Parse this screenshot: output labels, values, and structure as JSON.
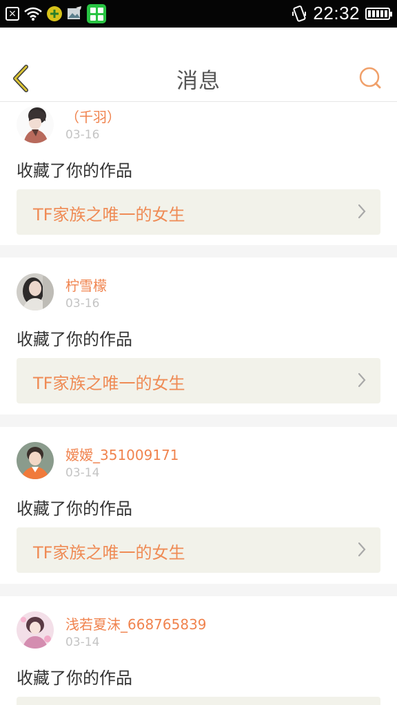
{
  "status_bar": {
    "time": "22:32",
    "icons": [
      "close-box-icon",
      "wifi-icon",
      "plus-app-icon",
      "image-app-icon",
      "grid-app-icon",
      "vibrate-icon",
      "battery-icon"
    ]
  },
  "header": {
    "title": "消息",
    "back_icon": "chevron-left-icon",
    "search_icon": "search-icon"
  },
  "colors": {
    "accent": "#f0834e",
    "back_icon": "#d9c234",
    "work_bg": "#f2f2ea"
  },
  "messages": [
    {
      "username": "（千羽）",
      "date": "03-16",
      "action": "收藏了你的作品",
      "work": "TF家族之唯一的女生"
    },
    {
      "username": "柠雪檬",
      "date": "03-16",
      "action": "收藏了你的作品",
      "work": "TF家族之唯一的女生"
    },
    {
      "username": "嫒嫒_351009171",
      "date": "03-14",
      "action": "收藏了你的作品",
      "work": "TF家族之唯一的女生"
    },
    {
      "username": "浅若夏沫_668765839",
      "date": "03-14",
      "action": "收藏了你的作品",
      "work": "TF家族之唯一的女生"
    }
  ]
}
